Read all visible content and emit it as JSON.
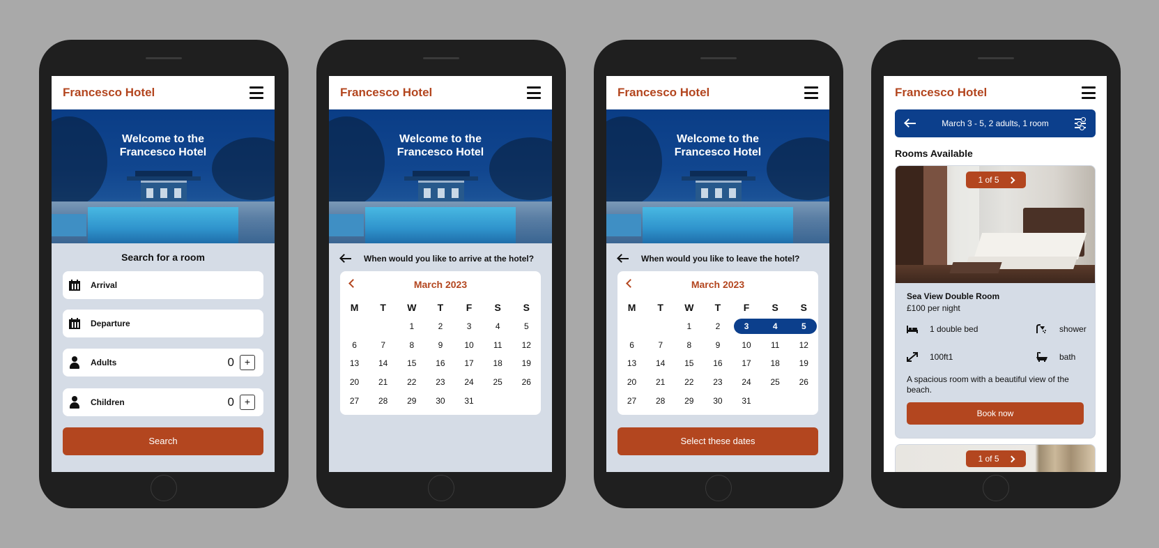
{
  "app": {
    "brand": "Francesco Hotel"
  },
  "hero": {
    "line1": "Welcome to the",
    "line2": "Francesco Hotel"
  },
  "screen1": {
    "title": "Search for a room",
    "fields": [
      {
        "label": "Arrival",
        "icon": "calendar-icon"
      },
      {
        "label": "Departure",
        "icon": "calendar-icon"
      }
    ],
    "counters": [
      {
        "label": "Adults",
        "value": "0",
        "plus": "+",
        "icon": "person-icon"
      },
      {
        "label": "Children",
        "value": "0",
        "plus": "+",
        "icon": "person-icon"
      }
    ],
    "search_label": "Search"
  },
  "calendar": {
    "month": "March 2023",
    "weekdays": [
      "M",
      "T",
      "W",
      "T",
      "F",
      "S",
      "S"
    ],
    "weeks": [
      [
        "",
        "",
        "1",
        "2",
        "3",
        "4",
        "5"
      ],
      [
        "6",
        "7",
        "8",
        "9",
        "10",
        "11",
        "12"
      ],
      [
        "13",
        "14",
        "15",
        "16",
        "17",
        "18",
        "19"
      ],
      [
        "20",
        "21",
        "22",
        "23",
        "24",
        "25",
        "26"
      ],
      [
        "27",
        "28",
        "29",
        "30",
        "31",
        "",
        ""
      ]
    ]
  },
  "screen2": {
    "question": "When would you like to arrive at the hotel?"
  },
  "screen3": {
    "question": "When would you like to leave the hotel?",
    "selected_days": [
      "3",
      "4",
      "5"
    ],
    "select_label": "Select these dates"
  },
  "screen4": {
    "summary": "March 3 - 5, 2 adults, 1 room",
    "rooms_title": "Rooms Available",
    "rooms": [
      {
        "pager": "1 of 5",
        "name": "Sea View Double Room",
        "price": "£100 per night",
        "amenities": [
          {
            "label": "1 double bed",
            "icon": "bed-icon"
          },
          {
            "label": "shower",
            "icon": "shower-icon"
          },
          {
            "label": "100ft1",
            "icon": "expand-icon"
          },
          {
            "label": "bath",
            "icon": "bathtub-icon"
          }
        ],
        "description": "A spacious room with a beautiful view of the beach.",
        "book_label": "Book now"
      },
      {
        "pager": "1 of 5"
      }
    ]
  },
  "colors": {
    "brand": "#b3461f",
    "navy": "#0c3f8c",
    "screen_bg": "#d5dce6",
    "page_bg": "#a9a9a9"
  }
}
